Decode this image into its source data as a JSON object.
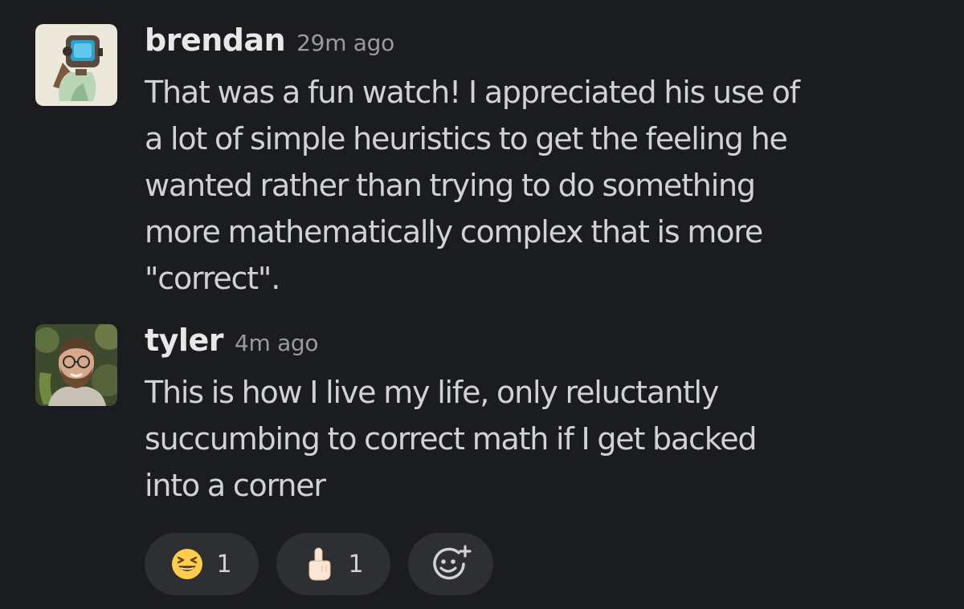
{
  "messages": [
    {
      "author": "brendan",
      "timestamp": "29m ago",
      "avatar": "robot-avatar-icon",
      "text": "That was a fun watch! I appreciated his use of\na lot of simple heuristics to get the feeling he\nwanted rather than trying to do something\nmore mathematically complex that is more\n\"correct\"."
    },
    {
      "author": "tyler",
      "timestamp": "4m ago",
      "avatar": "bearded-man-photo-avatar",
      "text": "This is how I live my life, only reluctantly\nsuccumbing to correct math if I get backed\ninto a corner"
    }
  ],
  "reactions": [
    {
      "emoji": "laughing-face-emoji",
      "count": "1"
    },
    {
      "emoji": "pointing-up-finger-emoji",
      "count": "1"
    }
  ],
  "add_reaction": {
    "icon": "add-reaction-smiley-plus-icon"
  },
  "colors": {
    "background": "#1b1c1f",
    "pill": "#2e2f33",
    "text": "#d1d2d3",
    "author": "#e8e8e8",
    "timestamp": "#9a9b9d"
  }
}
